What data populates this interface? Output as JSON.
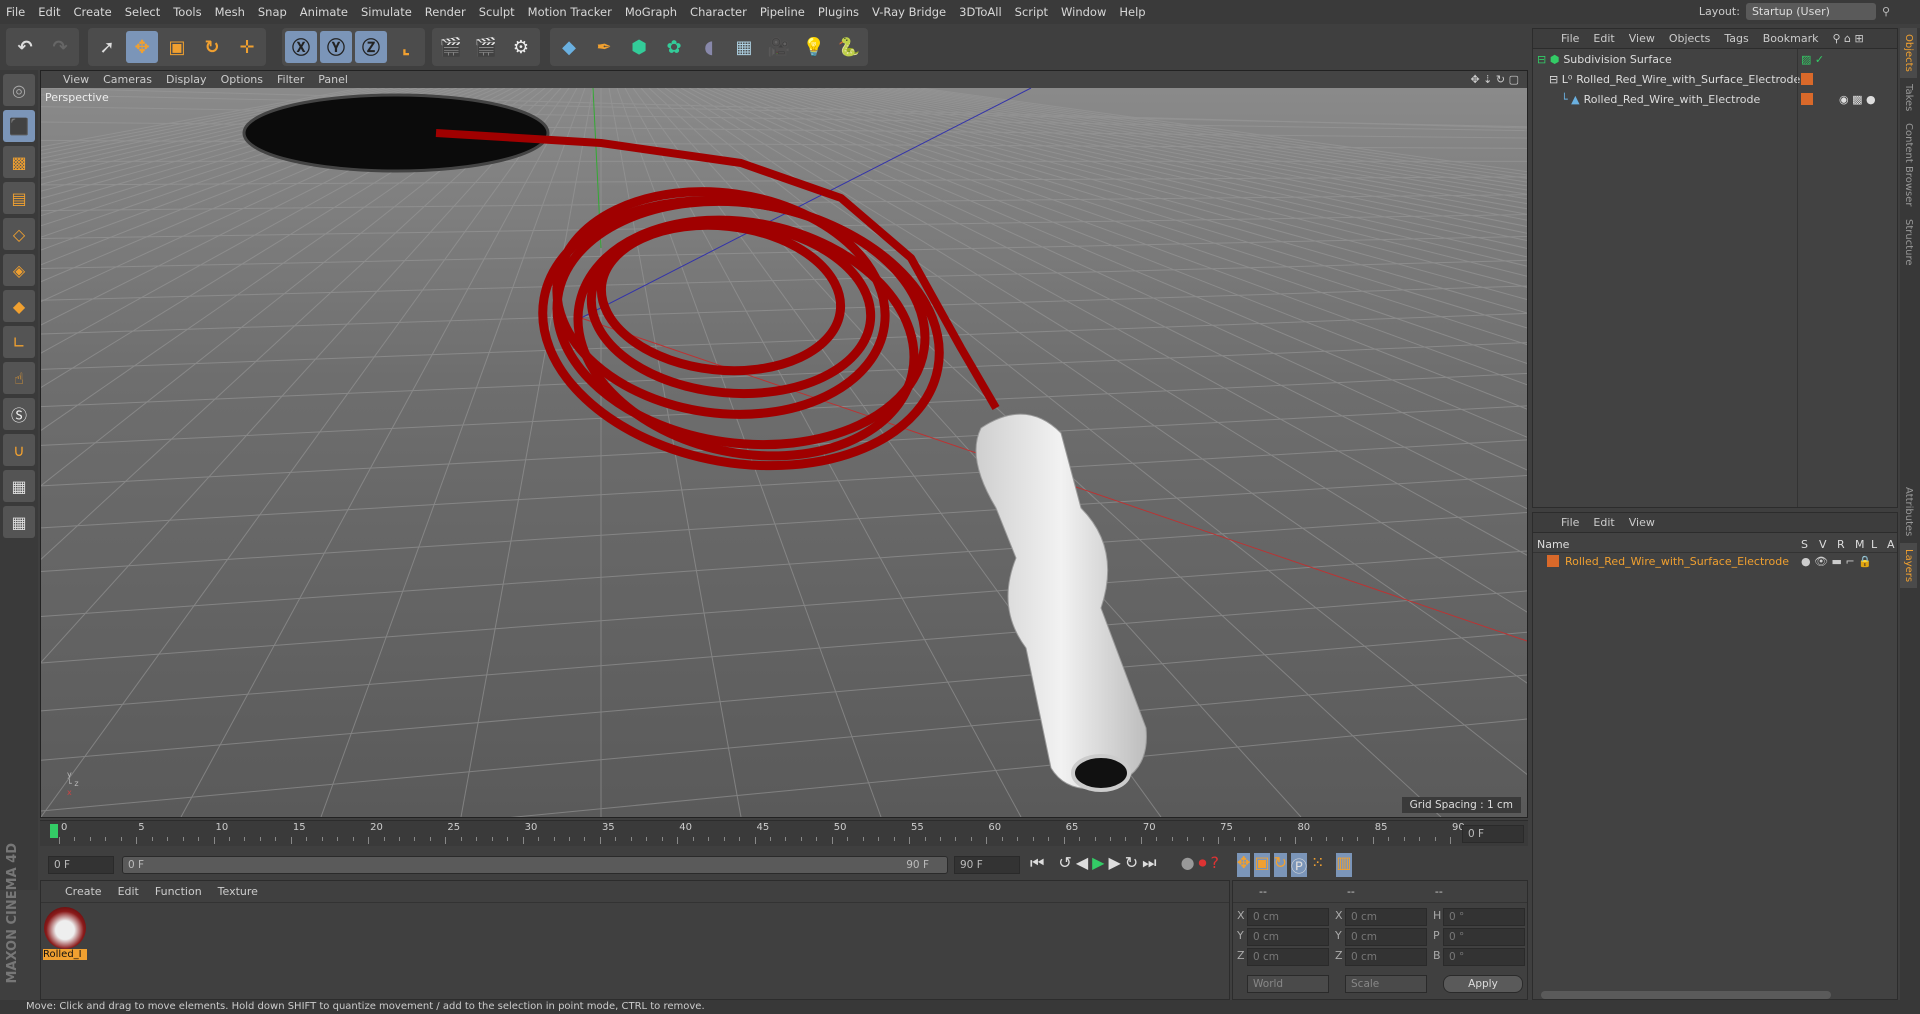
{
  "menu": [
    "File",
    "Edit",
    "Create",
    "Select",
    "Tools",
    "Mesh",
    "Snap",
    "Animate",
    "Simulate",
    "Render",
    "Sculpt",
    "Motion Tracker",
    "MoGraph",
    "Character",
    "Pipeline",
    "Plugins",
    "V-Ray Bridge",
    "3DToAll",
    "Script",
    "Window",
    "Help"
  ],
  "layout": {
    "label": "Layout:",
    "value": "Startup (User)"
  },
  "viewport": {
    "menu": [
      "View",
      "Cameras",
      "Display",
      "Options",
      "Filter",
      "Panel"
    ],
    "camera": "Perspective",
    "grid_spacing": "Grid Spacing : 1 cm"
  },
  "timeline": {
    "ticks": [
      "0",
      "5",
      "10",
      "15",
      "20",
      "25",
      "30",
      "35",
      "40",
      "45",
      "50",
      "55",
      "60",
      "65",
      "70",
      "75",
      "80",
      "85",
      "90"
    ],
    "current_frame": "0 F",
    "start": "0 F",
    "range_start": "0 F",
    "range_end": "90 F",
    "end": "90 F"
  },
  "material_manager": {
    "menu": [
      "Create",
      "Edit",
      "Function",
      "Texture"
    ],
    "material": "Rolled_I"
  },
  "coordinates": {
    "headers": [
      "--",
      "--",
      "--"
    ],
    "rows": [
      [
        "X",
        "0 cm",
        "X",
        "0 cm",
        "H",
        "0 °"
      ],
      [
        "Y",
        "0 cm",
        "Y",
        "0 cm",
        "P",
        "0 °"
      ],
      [
        "Z",
        "0 cm",
        "Z",
        "0 cm",
        "B",
        "0 °"
      ]
    ],
    "mode1": "World",
    "mode2": "Scale",
    "apply": "Apply"
  },
  "object_manager": {
    "menu": [
      "File",
      "Edit",
      "View",
      "Objects",
      "Tags",
      "Bookmark"
    ],
    "objects": [
      "Subdivision Surface",
      "Rolled_Red_Wire_with_Surface_Electrode",
      "Rolled_Red_Wire_with_Electrode"
    ]
  },
  "layer_manager": {
    "menu": [
      "File",
      "Edit",
      "View"
    ],
    "columns": [
      "Name",
      "S",
      "V",
      "R",
      "M",
      "L",
      "A"
    ],
    "layer": "Rolled_Red_Wire_with_Surface_Electrode"
  },
  "right_tabs": [
    "Objects",
    "Takes",
    "Content Browser",
    "Structure",
    "Attributes",
    "Layers"
  ],
  "brand": "MAXON CINEMA 4D",
  "status": "Move: Click and drag to move elements. Hold down SHIFT to quantize movement / add to the selection in point mode, CTRL to remove.",
  "colors": {
    "accent": "#f0a030",
    "selection": "#7b95b8",
    "wire": "#b00000",
    "layer": "#d9692a"
  }
}
